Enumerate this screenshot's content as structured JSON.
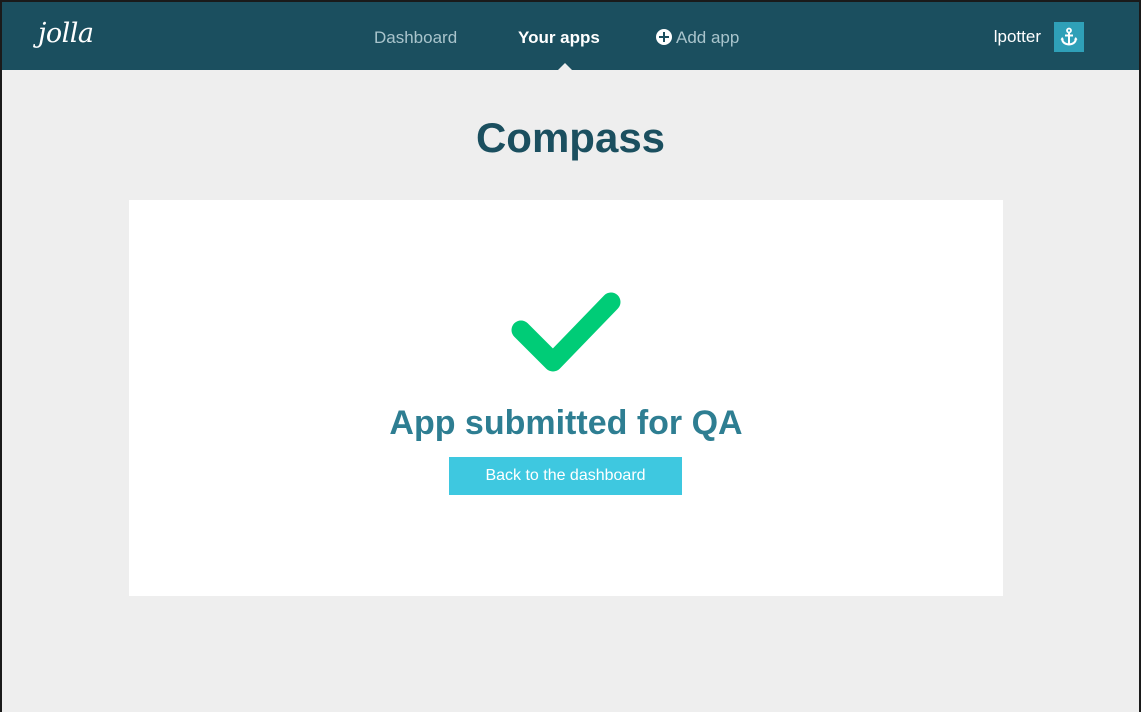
{
  "brand": {
    "logo_text": "jolla"
  },
  "nav": {
    "dashboard_label": "Dashboard",
    "your_apps_label": "Your apps",
    "add_app_label": "Add app",
    "active_item": "Your apps"
  },
  "user": {
    "name": "lpotter",
    "avatar_icon": "anchor-icon"
  },
  "page": {
    "title": "Compass"
  },
  "result": {
    "icon": "checkmark-icon",
    "message": "App submitted for QA",
    "button_label": "Back to the dashboard"
  },
  "colors": {
    "navbar_bg": "#1b4f5f",
    "accent": "#3ec8e0",
    "success_green": "#00cc77",
    "heading": "#1b4f5f",
    "status_text": "#2e7e92",
    "page_bg": "#eeeeee"
  }
}
